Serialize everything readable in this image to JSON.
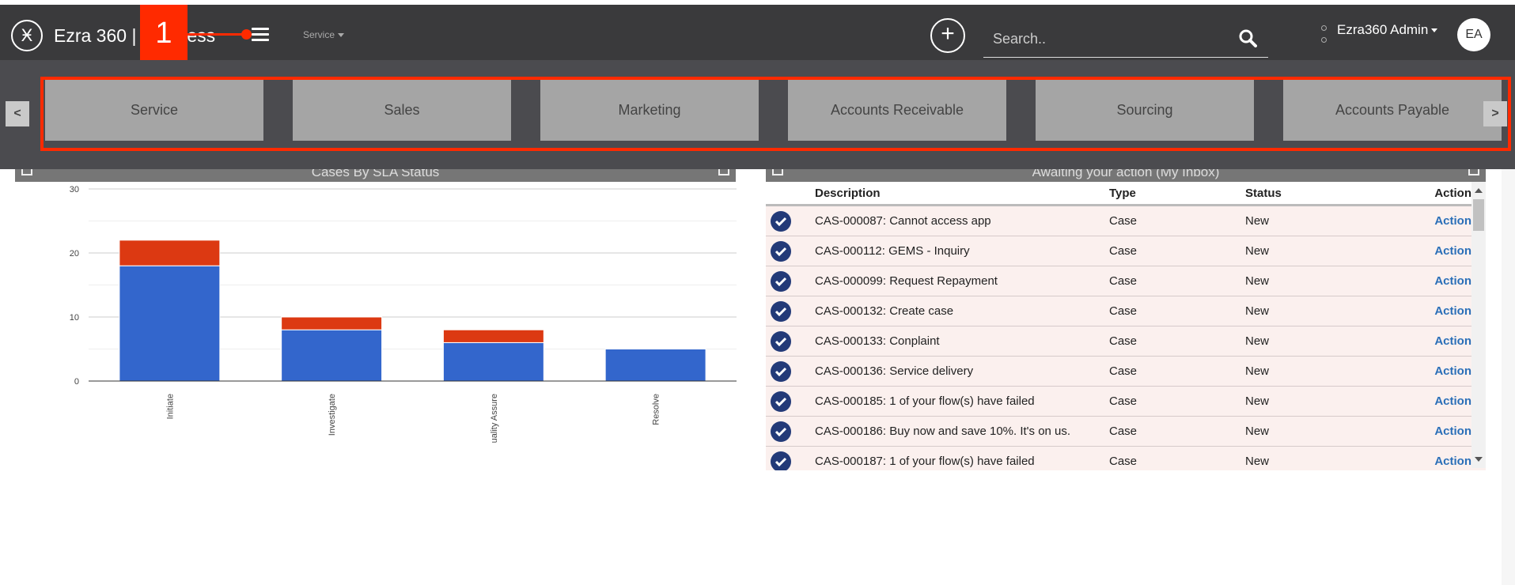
{
  "header": {
    "logo_glyph": "Ӿ",
    "app_title": "Ezra 360 | Business",
    "step_number": "1",
    "service_menu": "Service",
    "search_placeholder": "Search..",
    "user_name": "Ezra360 Admin",
    "avatar_initials": "EA",
    "add_label": "+"
  },
  "tiles": {
    "prev": "<",
    "next": ">",
    "items": [
      "Service",
      "Sales",
      "Marketing",
      "Accounts Receivable",
      "Sourcing",
      "Accounts Payable"
    ]
  },
  "left_panel": {
    "title": "Cases By SLA Status"
  },
  "right_panel": {
    "title": "Awaiting your action (My Inbox)"
  },
  "chart_data": {
    "type": "bar",
    "stacked": true,
    "categories": [
      "Initiate",
      "Investigate",
      "Quality Assure",
      "Resolve"
    ],
    "series": [
      {
        "values": [
          18,
          8,
          6,
          5
        ],
        "color": "#3366cc"
      },
      {
        "values": [
          4,
          2,
          2,
          0
        ],
        "color": "#dc3912"
      }
    ],
    "ylim": [
      0,
      30
    ],
    "yticks": [
      0,
      10,
      20,
      30
    ],
    "grid": true
  },
  "inbox": {
    "columns": [
      "Description",
      "Type",
      "Status",
      "Action"
    ],
    "rows": [
      {
        "description": "CAS-000087: Cannot access app",
        "type": "Case",
        "status": "New",
        "action": "Action"
      },
      {
        "description": "CAS-000112: GEMS - Inquiry",
        "type": "Case",
        "status": "New",
        "action": "Action"
      },
      {
        "description": "CAS-000099: Request Repayment",
        "type": "Case",
        "status": "New",
        "action": "Action"
      },
      {
        "description": "CAS-000132: Create case",
        "type": "Case",
        "status": "New",
        "action": "Action"
      },
      {
        "description": "CAS-000133: Conplaint",
        "type": "Case",
        "status": "New",
        "action": "Action"
      },
      {
        "description": "CAS-000136: Service delivery",
        "type": "Case",
        "status": "New",
        "action": "Action"
      },
      {
        "description": "CAS-000185: 1 of your flow(s) have failed",
        "type": "Case",
        "status": "New",
        "action": "Action"
      },
      {
        "description": "CAS-000186: Buy now and save 10%. It's on us.",
        "type": "Case",
        "status": "New",
        "action": "Action"
      },
      {
        "description": "CAS-000187: 1 of your flow(s) have failed",
        "type": "Case",
        "status": "New",
        "action": "Action"
      }
    ]
  },
  "colors": {
    "header_bg": "#3a3a3c",
    "tiles_band_bg": "#4b4b4f",
    "tile_bg": "#a5a5a5",
    "highlight": "#ff2a00",
    "action_link": "#2a6fb8",
    "check_icon": "#233a78"
  }
}
